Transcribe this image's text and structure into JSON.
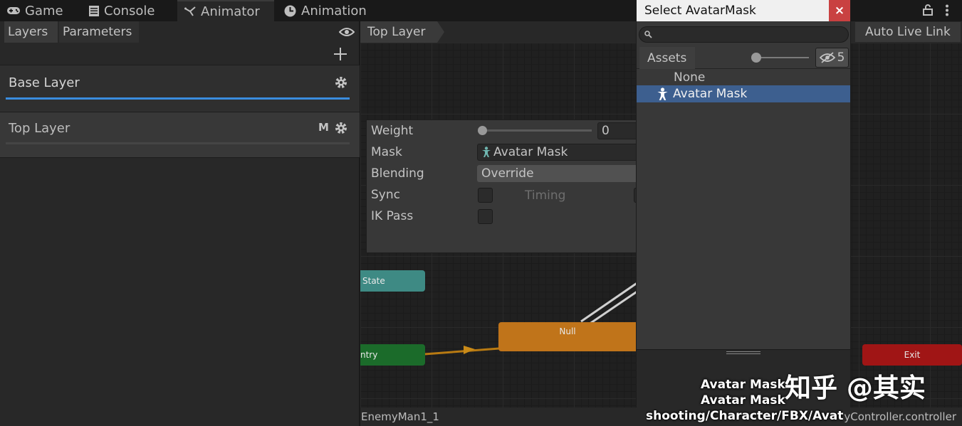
{
  "tabs": [
    {
      "label": "Game",
      "icon": "gamepad-icon"
    },
    {
      "label": "Console",
      "icon": "console-icon"
    },
    {
      "label": "Animator",
      "icon": "animator-icon"
    },
    {
      "label": "Animation",
      "icon": "clock-icon"
    }
  ],
  "left_panel": {
    "subtabs": [
      "Layers",
      "Parameters"
    ],
    "layers": [
      {
        "name": "Base Layer",
        "badge": ""
      },
      {
        "name": "Top Layer",
        "badge": "M"
      }
    ]
  },
  "breadcrumb": "Top Layer",
  "auto_live_link": "Auto Live Link",
  "layer_settings": {
    "weight_label": "Weight",
    "weight_value": "0",
    "weight_fraction": 0,
    "mask_label": "Mask",
    "mask_value": "Avatar Mask",
    "blending_label": "Blending",
    "blending_value": "Override",
    "sync_label": "Sync",
    "timing_label": "Timing",
    "ikpass_label": "IK Pass"
  },
  "nodes": {
    "any_state": "State",
    "entry": "ntry",
    "null": "Null",
    "exit": "Exit"
  },
  "picker": {
    "title": "Select AvatarMask",
    "close": "×",
    "search_placeholder": "",
    "assets_tab": "Assets",
    "hidden_count": "5",
    "items": [
      "None",
      "Avatar Mask"
    ],
    "selected_item": "Avatar Mask",
    "details": [
      "Avatar Mask",
      "Avatar Mask",
      "shooting/Character/FBX/Avat"
    ]
  },
  "status": {
    "left": "EnemyMan1_1",
    "right": "yController.controller"
  },
  "watermark": "知乎 @其实",
  "colors": {
    "selection": "#3d5f8f",
    "accent_underline": "#3a8dde",
    "entry_node": "#1b6b2a",
    "anystate_node": "#3e8a84",
    "null_node": "#c0741a",
    "exit_node": "#a01515",
    "close_button": "#c94141"
  }
}
